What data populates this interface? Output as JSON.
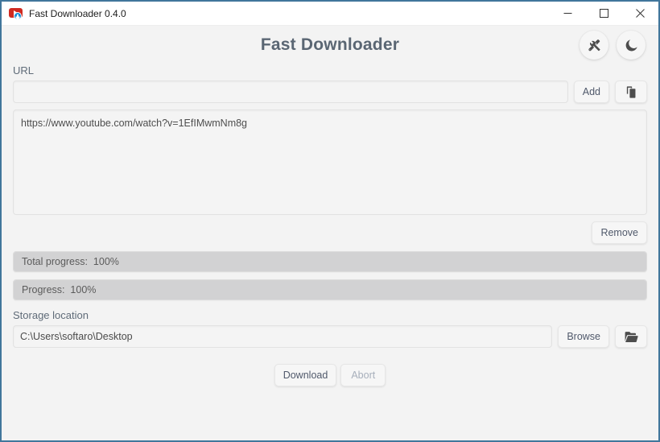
{
  "window": {
    "title": "Fast Downloader 0.4.0",
    "app_icon": "youtube-download-icon",
    "border_color": "#41769b",
    "controls": {
      "minimize": "minimize-icon",
      "maximize": "maximize-icon",
      "close": "close-icon"
    }
  },
  "header": {
    "title": "Fast Downloader",
    "title_color": "#5a6673",
    "settings_icon": "tools-icon",
    "theme_icon": "moon-icon"
  },
  "url_section": {
    "label": "URL",
    "input_value": "",
    "input_placeholder": "",
    "add_label": "Add",
    "paste_icon": "clipboard-icon"
  },
  "url_list": {
    "items": [
      "https://www.youtube.com/watch?v=1EfIMwmNm8g"
    ],
    "remove_label": "Remove"
  },
  "progress": {
    "total": {
      "label": "Total progress:",
      "value": "100%",
      "text": "Total progress:  100%",
      "percent": 100
    },
    "current": {
      "label": "Progress:",
      "value": "100%",
      "text": "Progress:  100%",
      "percent": 100
    },
    "fill_color": "#d2d2d3"
  },
  "storage": {
    "label": "Storage location",
    "path": "C:\\Users\\softaro\\Desktop",
    "browse_label": "Browse",
    "folder_icon": "open-folder-icon"
  },
  "actions": {
    "download_label": "Download",
    "abort_label": "Abort",
    "abort_disabled": true
  }
}
